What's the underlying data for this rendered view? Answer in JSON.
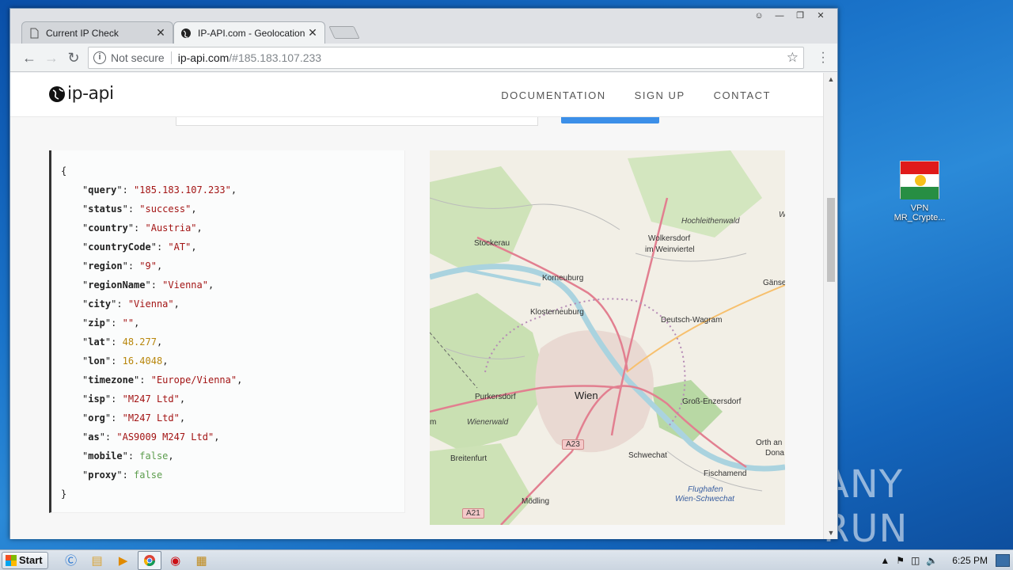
{
  "desktop": {
    "icon_label_1": "VPN",
    "icon_label_2": "MR_Crypte...",
    "watermark": "ANY RUN"
  },
  "browser": {
    "tabs": [
      {
        "title": "Current IP Check",
        "icon": "page-icon"
      },
      {
        "title": "IP-API.com - Geolocation AP",
        "icon": "globe-icon"
      }
    ],
    "close_glyph": "✕",
    "address": {
      "security_label": "Not secure",
      "host": "ip-api.com",
      "path": "/#185.183.107.233"
    }
  },
  "site": {
    "logo_text": "ip-api",
    "nav": [
      "DOCUMENTATION",
      "SIGN UP",
      "CONTACT"
    ]
  },
  "json": {
    "open": "{",
    "close": "}",
    "fields": [
      {
        "key": "query",
        "value": "\"185.183.107.233\"",
        "type": "s"
      },
      {
        "key": "status",
        "value": "\"success\"",
        "type": "s"
      },
      {
        "key": "country",
        "value": "\"Austria\"",
        "type": "s"
      },
      {
        "key": "countryCode",
        "value": "\"AT\"",
        "type": "s"
      },
      {
        "key": "region",
        "value": "\"9\"",
        "type": "s"
      },
      {
        "key": "regionName",
        "value": "\"Vienna\"",
        "type": "s"
      },
      {
        "key": "city",
        "value": "\"Vienna\"",
        "type": "s"
      },
      {
        "key": "zip",
        "value": "\"\"",
        "type": "s"
      },
      {
        "key": "lat",
        "value": "48.277",
        "type": "n"
      },
      {
        "key": "lon",
        "value": "16.4048",
        "type": "n"
      },
      {
        "key": "timezone",
        "value": "\"Europe/Vienna\"",
        "type": "s"
      },
      {
        "key": "isp",
        "value": "\"M247 Ltd\"",
        "type": "s"
      },
      {
        "key": "org",
        "value": "\"M247 Ltd\"",
        "type": "s"
      },
      {
        "key": "as",
        "value": "\"AS9009 M247 Ltd\"",
        "type": "s"
      },
      {
        "key": "mobile",
        "value": "false",
        "type": "b"
      },
      {
        "key": "proxy",
        "value": "false",
        "type": "b"
      }
    ]
  },
  "map": {
    "labels": {
      "hochleithenwald": "Hochleithenwald",
      "stockerau": "Stockerau",
      "wolkersdorf1": "Wolkersdorf",
      "wolkersdorf2": "im Weinviertel",
      "korneuburg": "Korneuburg",
      "ganse": "Gänse",
      "klosterneuburg": "Klosterneuburg",
      "deutsch_wagram": "Deutsch-Wagram",
      "wien": "Wien",
      "purkersdorf": "Purkersdorf",
      "gross_enzersdorf": "Groß-Enzersdorf",
      "wienerwald": "Wienerwald",
      "a23": "A23",
      "orth1": "Orth an",
      "orth2": "Dona",
      "breitenfurt": "Breitenfurt",
      "schwechat": "Schwechat",
      "fischamend": "Fischamend",
      "flughafen1": "Flughafen",
      "flughafen2": "Wien-Schwechat",
      "modling": "Mödling",
      "a21": "A21",
      "m": "m",
      "w": "W"
    }
  },
  "taskbar": {
    "start_label": "Start",
    "clock": "6:25 PM"
  }
}
